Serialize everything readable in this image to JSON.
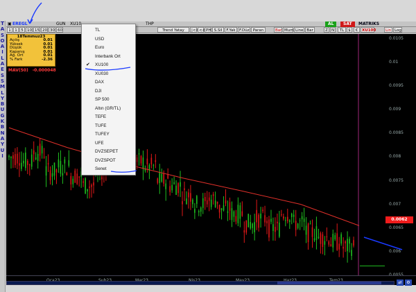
{
  "leftbar_letters": [
    "T",
    "A",
    "S",
    "O",
    "A",
    "I",
    "L",
    "A",
    "E",
    "S",
    "S",
    "M",
    "L",
    "Y",
    "B",
    "U",
    "G",
    "K",
    "B",
    "N",
    "A",
    "Y",
    "U",
    "I"
  ],
  "toolbar1": {
    "symbol": "EREGL",
    "tf": "GUN",
    "mode": "XU10",
    "extra": "THP",
    "right_brand": "MATRIKS",
    "al": "AL",
    "sat": "SAT"
  },
  "toolbar2": {
    "periods": [
      "1",
      "5",
      "10",
      "15",
      "20",
      "30",
      "60"
    ],
    "left_tail": "1",
    "hidden_after_menu": "THP",
    "tools": [
      "Trend Yatay",
      "|<<",
      "<<",
      "PH",
      "S.Sil",
      "F.Yak",
      "F.Düz",
      "Paran"
    ],
    "bar_buttons": [
      "Bar",
      "Mum",
      "Line",
      "Bar"
    ],
    "right_buttons": [
      "Z",
      "N",
      "TL",
      "$",
      "€",
      "XU100",
      "Lin",
      "Log"
    ]
  },
  "info": {
    "date": "18Temmuz23",
    "rows": [
      {
        "k": "Açılış",
        "v": "0.01"
      },
      {
        "k": "Yüksek",
        "v": "0.01"
      },
      {
        "k": "Düşük",
        "v": "0.01"
      },
      {
        "k": "Kapanış",
        "v": "0.01"
      },
      {
        "k": "Ağ. Ort",
        "v": "0.01"
      },
      {
        "k": "% Fark",
        "v": "-2.36"
      }
    ]
  },
  "mav": {
    "label": "MAV(50)",
    "value": "-0.000048"
  },
  "y_ticks": [
    "0.0105",
    "0.01",
    "0.0095",
    "0.009",
    "0.0085",
    "0.008",
    "0.0075",
    "0.007",
    "0.0065",
    "0.006",
    "0.0055"
  ],
  "price_marker": "0.0062",
  "x_ticks": [
    "Oca23",
    "Şub23",
    "Mar23",
    "Nis23",
    "May23",
    "Haz23",
    "Tem23"
  ],
  "menu_items": [
    {
      "label": "TL",
      "checked": false
    },
    {
      "label": "USD",
      "checked": false
    },
    {
      "label": "Euro",
      "checked": false
    },
    {
      "label": "Interbank Ort",
      "checked": false
    },
    {
      "label": "XU100",
      "checked": true
    },
    {
      "label": "XU030",
      "checked": false
    },
    {
      "label": "DAX",
      "checked": false
    },
    {
      "label": "DJI",
      "checked": false
    },
    {
      "label": "SP 500",
      "checked": false
    },
    {
      "label": "Altın (GR/TL)",
      "checked": false
    },
    {
      "label": "TEFE",
      "checked": false
    },
    {
      "label": "TUFE",
      "checked": false
    },
    {
      "label": "TUFEY",
      "checked": false
    },
    {
      "label": "UFE",
      "checked": false
    },
    {
      "label": "DVZSEPET",
      "checked": false
    },
    {
      "label": "DVZSPOT",
      "checked": false
    },
    {
      "label": "Senet",
      "checked": false
    }
  ],
  "colors": {
    "up": "#20c020",
    "down": "#e01818",
    "ma": "#e0302a",
    "bg": "#000000",
    "annot": "#1a3aff",
    "highlight": "#ff2020"
  },
  "chart_data": {
    "type": "line",
    "series": [
      {
        "name": "MAV(50)",
        "x": [
          "Oca23",
          "Şub23",
          "Mar23",
          "Nis23",
          "May23",
          "Haz23",
          "Tem23"
        ],
        "values": [
          0.00862,
          0.0082,
          0.00785,
          0.00755,
          0.00728,
          0.007,
          0.00655
        ]
      }
    ],
    "candles_close": [
      0.008,
      0.0079,
      0.0081,
      0.0077,
      0.0078,
      0.0076,
      0.0074,
      0.0077,
      0.0082,
      0.008,
      0.0079,
      0.0078,
      0.0075,
      0.0074,
      0.0072,
      0.007,
      0.0071,
      0.0069,
      0.0068,
      0.0066,
      0.0067,
      0.0065,
      0.0068,
      0.0066,
      0.0064,
      0.0063,
      0.0062,
      0.0061
    ],
    "ylim": [
      0.0055,
      0.0106
    ],
    "last_price": "0.0062"
  }
}
